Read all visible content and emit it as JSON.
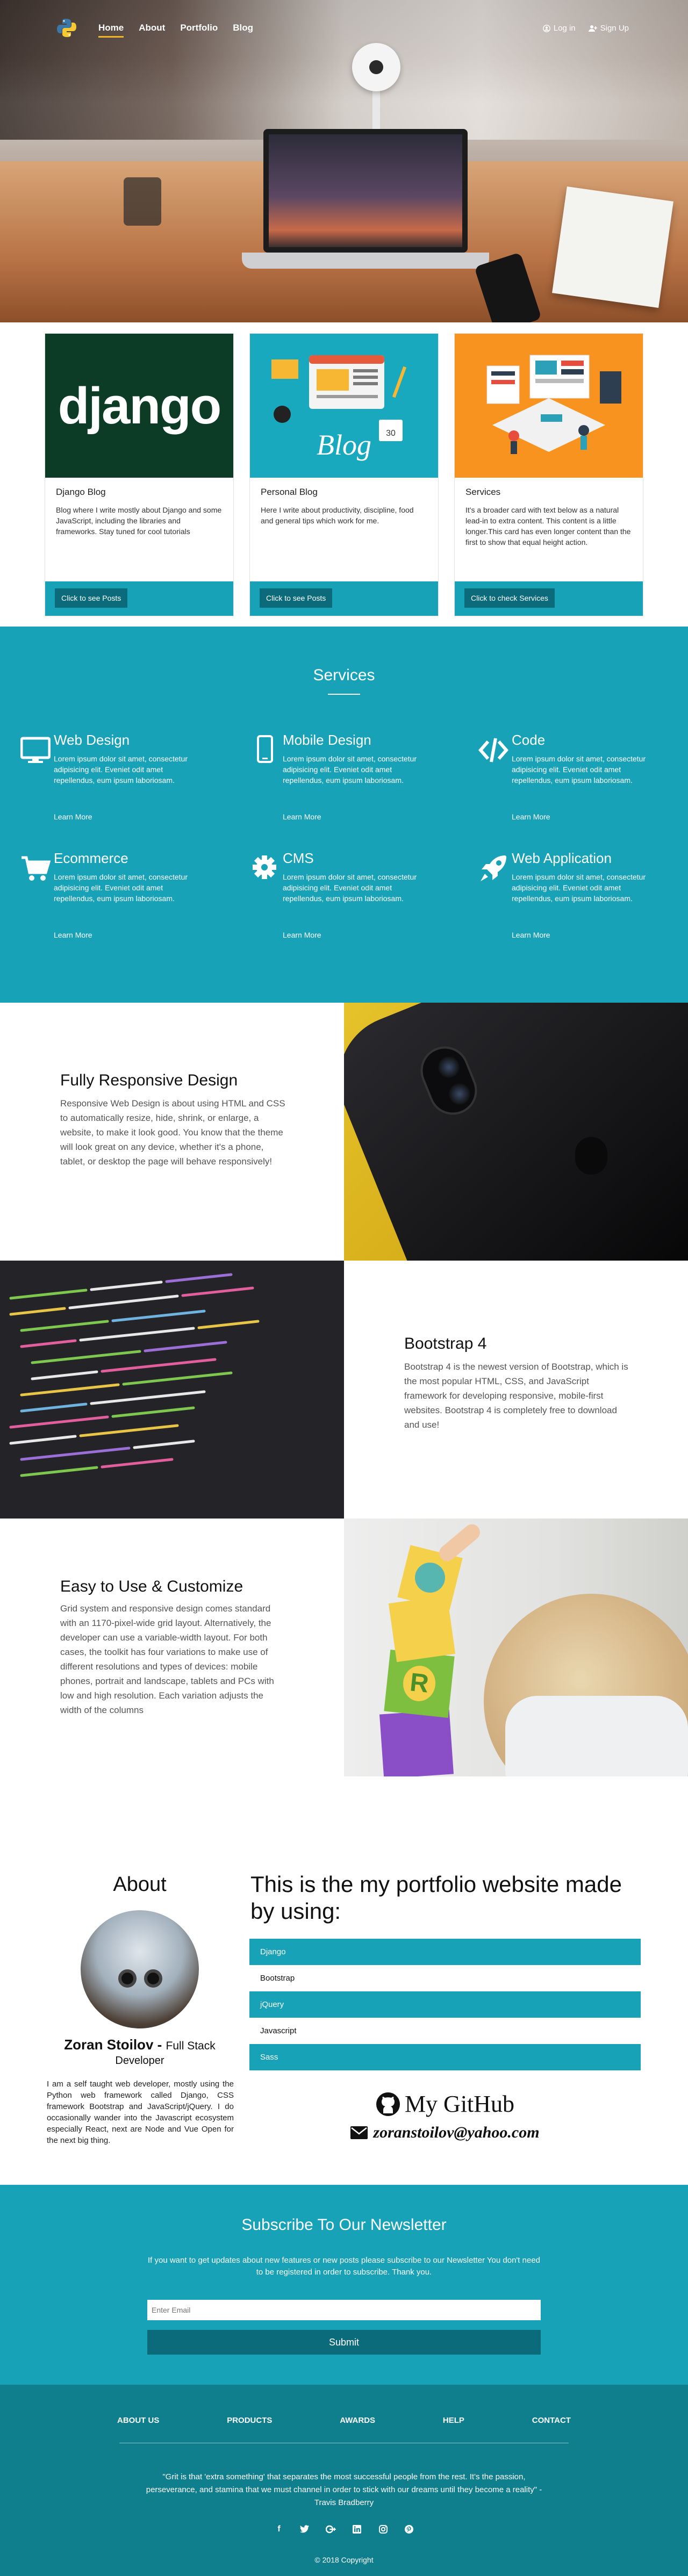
{
  "nav": {
    "links": [
      "Home",
      "About",
      "Portfolio",
      "Blog"
    ],
    "login_label": "Log in",
    "signup_label": "Sign Up"
  },
  "cards": [
    {
      "image_word": "django",
      "title": "Django Blog",
      "text": "Blog where I write mostly about Django and some JavaScript, including the libraries and frameworks. Stay tuned for cool tutorials",
      "button": "Click to see Posts"
    },
    {
      "image_word": "Blog",
      "title": "Personal Blog",
      "text": "Here I write about productivity, discipline, food and general tips which work for me.",
      "button": "Click to see Posts"
    },
    {
      "title": "Services",
      "text": "It's a broader card with text below as a natural lead-in to extra content. This content is a little longer.This card has even longer content than the first to show that equal height action.",
      "button": "Click to check Services"
    }
  ],
  "services": {
    "heading": "Services",
    "items": [
      {
        "icon": "monitor-icon",
        "name": "Web Design",
        "desc": "Lorem ipsum dolor sit amet, consectetur adipisicing elit. Eveniet odit amet repellendus, eum ipsum laboriosam.",
        "more": "Learn More"
      },
      {
        "icon": "mobile-icon",
        "name": "Mobile Design",
        "desc": "Lorem ipsum dolor sit amet, consectetur adipisicing elit. Eveniet odit amet repellendus, eum ipsum laboriosam.",
        "more": "Learn More"
      },
      {
        "icon": "code-icon",
        "name": "Code",
        "desc": "Lorem ipsum dolor sit amet, consectetur adipisicing elit. Eveniet odit amet repellendus, eum ipsum laboriosam.",
        "more": "Learn More"
      },
      {
        "icon": "cart-icon",
        "name": "Ecommerce",
        "desc": "Lorem ipsum dolor sit amet, consectetur adipisicing elit. Eveniet odit amet repellendus, eum ipsum laboriosam.",
        "more": "Learn More"
      },
      {
        "icon": "gear-icon",
        "name": "CMS",
        "desc": "Lorem ipsum dolor sit amet, consectetur adipisicing elit. Eveniet odit amet repellendus, eum ipsum laboriosam.",
        "more": "Learn More"
      },
      {
        "icon": "rocket-icon",
        "name": "Web Application",
        "desc": "Lorem ipsum dolor sit amet, consectetur adipisicing elit. Eveniet odit amet repellendus, eum ipsum laboriosam.",
        "more": "Learn More"
      }
    ]
  },
  "features": [
    {
      "title": "Fully Responsive Design",
      "text": "Responsive Web Design is about using HTML and CSS to automatically resize, hide, shrink, or enlarge, a website, to make it look good. You know that the theme will look great on any device, whether it's a phone, tablet, or desktop the page will behave responsively!"
    },
    {
      "title": "Bootstrap 4",
      "text": "Bootstrap 4 is the newest version of Bootstrap, which is the most popular HTML, CSS, and JavaScript framework for developing responsive, mobile-first websites. Bootstrap 4 is completely free to download and use!"
    },
    {
      "title": "Easy to Use & Customize",
      "text": "Grid system and responsive design comes standard with an 1170-pixel-wide grid layout. Alternatively, the developer can use a variable-width layout. For both cases, the toolkit has four variations to make use of different resolutions and types of devices: mobile phones, portrait and landscape, tablets and PCs with low and high resolution. Each variation adjusts the width of the columns"
    }
  ],
  "about": {
    "heading": "About",
    "name": "Zoran Stoilov - ",
    "role_a": "Full Stack",
    "role_b": "Developer",
    "bio": "I am a self taught web developer, mostly using the Python web framework called Django, CSS framework Bootstrap and JavaScript/jQuery. I do occasionally wander into the Javascript ecosystem especially React, next are Node and Vue Open for the next big thing.",
    "portfolio_heading": "This is the my portfolio website made by using:",
    "skills": [
      "Django",
      "Bootstrap",
      "jQuery",
      "Javascript",
      "Sass"
    ],
    "github": "My GitHub",
    "email": "zoranstoilov@yahoo.com"
  },
  "newsletter": {
    "heading": "Subscribe To Our Newsletter",
    "text": "If you want to get updates about new features or new posts please subscribe to our Newsletter You don't need to be registered in order to subscribe. Thank you.",
    "placeholder": "Enter Email",
    "button": "Submit"
  },
  "footer": {
    "links": [
      "ABOUT US",
      "PRODUCTS",
      "AWARDS",
      "HELP",
      "CONTACT"
    ],
    "quote": "\"Grit is that 'extra something' that separates the most successful people from the rest. It's the passion, perseverance, and stamina that we must channel in order to stick with our dreams until they become a reality\" - Travis Bradberry",
    "social_icons": [
      "facebook-icon",
      "twitter-icon",
      "google-plus-icon",
      "linkedin-icon",
      "instagram-icon",
      "pinterest-icon"
    ],
    "copyright": "© 2018 Copyright"
  },
  "colors": {
    "accent": "#17a2b8",
    "accent_dark": "#0b6b7a",
    "footer": "#0f7f8e",
    "nav_underline": "#f0b429",
    "django_green": "#0c3c26",
    "orange": "#f7931e"
  }
}
